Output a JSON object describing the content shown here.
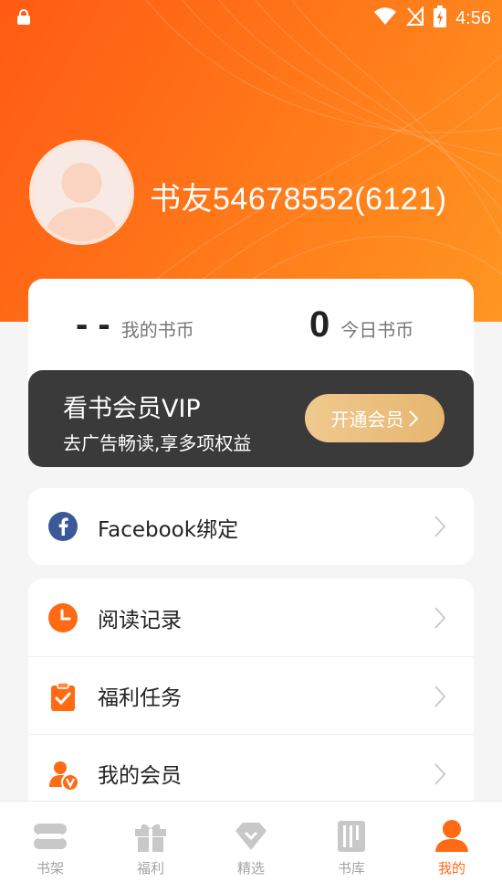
{
  "status_bar": {
    "time": "4:56"
  },
  "profile": {
    "username": "书友54678552(6121)"
  },
  "coins": {
    "my_coins_value": "- -",
    "my_coins_label": "我的书币",
    "today_coins_value": "0",
    "today_coins_label": "今日书币"
  },
  "vip": {
    "title": "看书会员VIP",
    "subtitle": "去广告畅读,享多项权益",
    "button_label": "开通会员"
  },
  "bind_card": {
    "facebook_label": "Facebook绑定"
  },
  "menu": {
    "items": [
      {
        "label": "阅读记录",
        "icon": "clock-icon"
      },
      {
        "label": "福利任务",
        "icon": "clipboard-check-icon"
      },
      {
        "label": "我的会员",
        "icon": "member-icon"
      }
    ]
  },
  "tabbar": {
    "tabs": [
      {
        "label": "书架",
        "icon": "bookshelf-icon"
      },
      {
        "label": "福利",
        "icon": "gift-icon"
      },
      {
        "label": "精选",
        "icon": "diamond-icon"
      },
      {
        "label": "书库",
        "icon": "library-icon"
      },
      {
        "label": "我的",
        "icon": "person-icon"
      }
    ],
    "active_index": 4
  },
  "colors": {
    "accent": "#ff6a14",
    "vip_card": "#3a3a3a",
    "vip_button": "#e9bd7c",
    "facebook": "#3b5998"
  }
}
